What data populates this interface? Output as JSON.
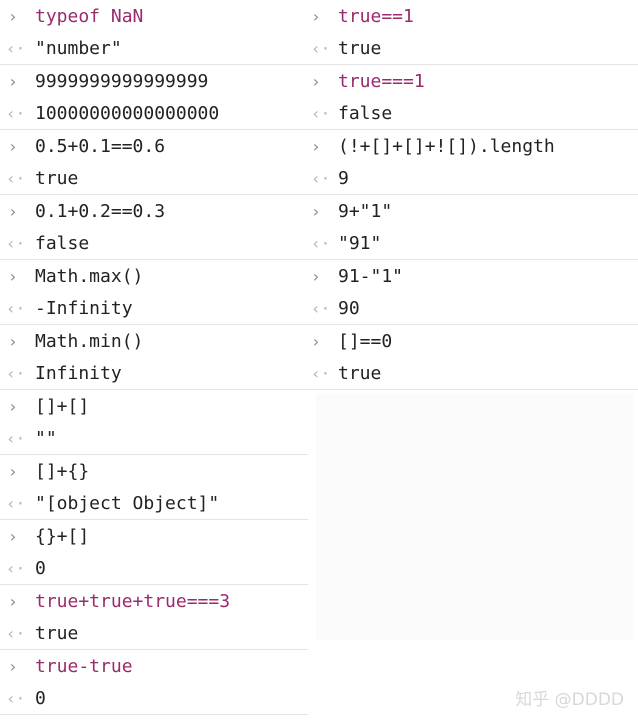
{
  "left_entries": [
    {
      "input": "typeof NaN",
      "output": "\"number\"",
      "input_class": "kw"
    },
    {
      "input": "9999999999999999",
      "output": "10000000000000000"
    },
    {
      "input": "0.5+0.1==0.6",
      "output": "true"
    },
    {
      "input": "0.1+0.2==0.3",
      "output": "false"
    },
    {
      "input": "Math.max()",
      "output": "-Infinity"
    },
    {
      "input": "Math.min()",
      "output": "Infinity"
    },
    {
      "input": "[]+[]",
      "output": "\"\""
    },
    {
      "input": "[]+{}",
      "output": "\"[object Object]\""
    },
    {
      "input": "{}+[]",
      "output": "0"
    },
    {
      "input": "true+true+true===3",
      "output": "true",
      "input_class": "kw"
    },
    {
      "input": "true-true",
      "output": "0",
      "input_class": "kw"
    }
  ],
  "right_entries": [
    {
      "input": "true==1",
      "output": "true",
      "input_class": "kw"
    },
    {
      "input": "true===1",
      "output": "false",
      "input_class": "kw"
    },
    {
      "input": "(!+[]+[]+![]).length",
      "output": "9"
    },
    {
      "input": "9+\"1\"",
      "output": "\"91\""
    },
    {
      "input": "91-\"1\"",
      "output": "90"
    },
    {
      "input": "[]==0",
      "output": "true"
    }
  ],
  "icons": {
    "input_prompt": "chevron-right-icon",
    "result_arrow": "chevron-left-icon"
  },
  "watermark": "知乎 @DDDD"
}
